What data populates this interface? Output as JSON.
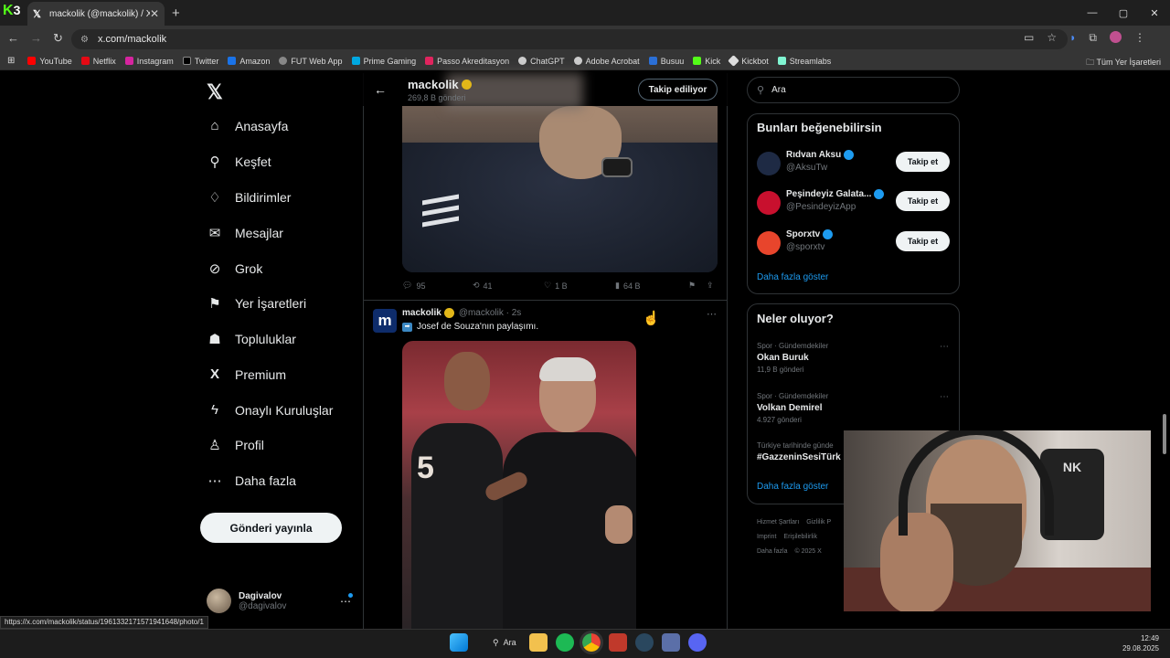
{
  "browser": {
    "tab_title": "mackolik (@mackolik) / X",
    "tab_close": "✕",
    "new_tab": "+",
    "overlay_logo": "K",
    "overlay_number": "3",
    "url": "x.com/mackolik",
    "window_controls": [
      "—",
      "▢",
      "✕"
    ],
    "bookmarks": [
      {
        "label": "YouTube",
        "color": "#ff0000"
      },
      {
        "label": "Netflix",
        "color": "#e50914"
      },
      {
        "label": "Instagram",
        "color": "#d6249f"
      },
      {
        "label": "Twitter",
        "color": "#000000"
      },
      {
        "label": "Amazon",
        "color": "#1a73e8"
      },
      {
        "label": "FUT Web App",
        "color": "#888888"
      },
      {
        "label": "Prime Gaming",
        "color": "#00a8e1"
      },
      {
        "label": "Passo Akreditasyon",
        "color": "#e0245e"
      },
      {
        "label": "ChatGPT",
        "color": "#cccccc"
      },
      {
        "label": "Adobe Acrobat",
        "color": "#cccccc"
      },
      {
        "label": "Busuu",
        "color": "#2b6fd6"
      },
      {
        "label": "Kick",
        "color": "#53fc18"
      },
      {
        "label": "Kickbot",
        "color": "#dddddd"
      },
      {
        "label": "Streamlabs",
        "color": "#80f5d2"
      }
    ],
    "all_bookmarks": "Tüm Yer İşaretleri",
    "status_url": "https://x.com/mackolik/status/1961332171571941648/photo/1"
  },
  "nav": {
    "items": [
      {
        "label": "Anasayfa",
        "icon": "⌂"
      },
      {
        "label": "Keşfet",
        "icon": "⚲"
      },
      {
        "label": "Bildirimler",
        "icon": "♢"
      },
      {
        "label": "Mesajlar",
        "icon": "✉"
      },
      {
        "label": "Grok",
        "icon": "⊘"
      },
      {
        "label": "Yer İşaretleri",
        "icon": "⚑"
      },
      {
        "label": "Topluluklar",
        "icon": "☗"
      },
      {
        "label": "Premium",
        "icon": "X"
      },
      {
        "label": "Onaylı Kuruluşlar",
        "icon": "ϟ"
      },
      {
        "label": "Profil",
        "icon": "♙"
      },
      {
        "label": "Daha fazla",
        "icon": "⋯"
      }
    ],
    "post_button": "Gönderi yayınla",
    "account_name": "Dagivalov",
    "account_handle": "@dagivalov"
  },
  "profile_header": {
    "name": "mackolik",
    "posts_count": "269,8 B gönderi",
    "following_button": "Takip ediliyor"
  },
  "tweet1": {
    "replies": "95",
    "retweets": "41",
    "likes": "1 B",
    "views": "64 B"
  },
  "tweet2": {
    "author": "mackolik",
    "handle_time": "@mackolik · 2s",
    "avatar_letter": "m",
    "text": "Josef de Souza'nın paylaşımı.",
    "jersey_number": "5"
  },
  "sidebar": {
    "search_placeholder": "Ara",
    "who_to_follow_title": "Bunları beğenebilirsin",
    "suggestions": [
      {
        "name": "Rıdvan Aksu",
        "handle": "@AksuTw",
        "button": "Takip et",
        "color": "#1e2a44"
      },
      {
        "name": "Peşindeyiz Galata...",
        "handle": "@PesindeyizApp",
        "button": "Takip et",
        "color": "#c8102e"
      },
      {
        "name": "Sporxtv",
        "handle": "@sporxtv",
        "button": "Takip et",
        "color": "#e8452c"
      }
    ],
    "show_more": "Daha fazla göster",
    "trends_title": "Neler oluyor?",
    "trends": [
      {
        "context": "Spor · Gündemdekiler",
        "name": "Okan Buruk",
        "count": "11,9 B gönderi"
      },
      {
        "context": "Spor · Gündemdekiler",
        "name": "Volkan Demirel",
        "count": "4.927 gönderi"
      },
      {
        "context": "Türkiye tarihinde günde",
        "name": "#GazzeninSesiTürk",
        "count": ""
      }
    ],
    "trends_more": "Daha fazla göster",
    "footer": [
      "Hizmet Şartları",
      "Gizlilik P",
      "Imprint",
      "Erişilebilirlik",
      "Daha fazla",
      "© 2025 X"
    ]
  },
  "webcam": {
    "chair_text": "NK"
  },
  "taskbar": {
    "search": "Ara",
    "time": "12:49",
    "date": "29.08.2025"
  }
}
